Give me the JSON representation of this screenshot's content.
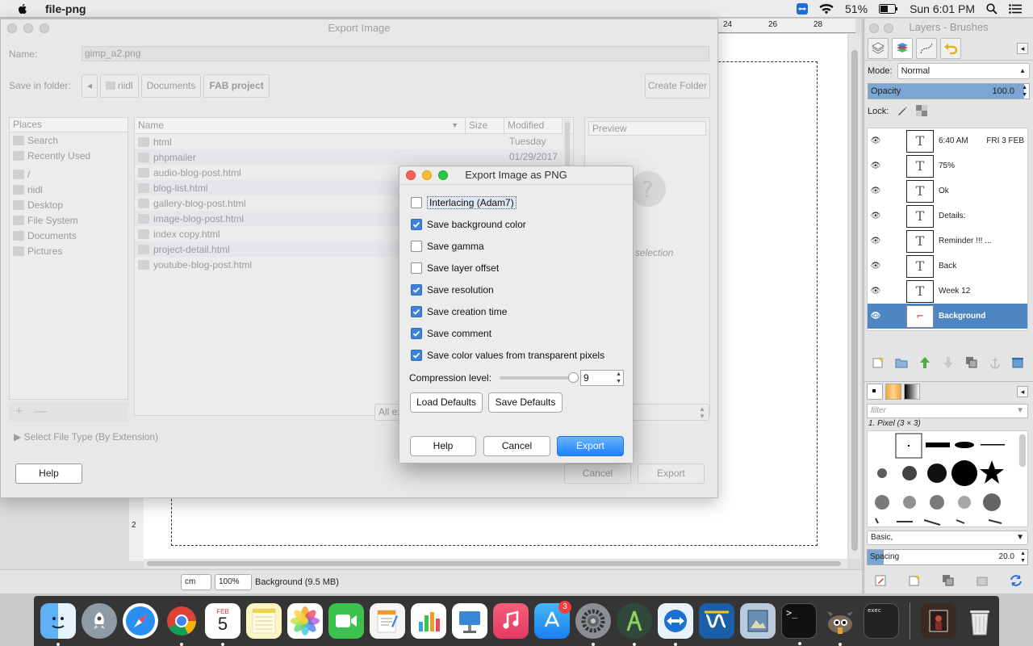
{
  "menubar": {
    "app_name": "file-png",
    "battery": "51%",
    "clock": "Sun 6:01 PM"
  },
  "export_dialog": {
    "title": "Export Image",
    "name_label": "Name:",
    "name_value": "gimp_a2.png",
    "folder_label": "Save in folder:",
    "breadcrumbs": [
      "riidl",
      "Documents",
      "FAB project"
    ],
    "create_folder": "Create Folder",
    "places_header": "Places",
    "places": [
      "Search",
      "Recently Used",
      "/",
      "riidl",
      "Desktop",
      "File System",
      "Documents",
      "Pictures"
    ],
    "columns": {
      "name": "Name",
      "size": "Size",
      "modified": "Modified"
    },
    "files": [
      {
        "name": "html",
        "modified": "Tuesday"
      },
      {
        "name": "phpmailer",
        "modified": "01/29/2017"
      },
      {
        "name": "audio-blog-post.html",
        "modified": ""
      },
      {
        "name": "blog-list.html",
        "modified": ""
      },
      {
        "name": "gallery-blog-post.html",
        "modified": ""
      },
      {
        "name": "image-blog-post.html",
        "modified": ""
      },
      {
        "name": "index copy.html",
        "modified": ""
      },
      {
        "name": "project-detail.html",
        "modified": ""
      },
      {
        "name": "youtube-blog-post.html",
        "modified": ""
      }
    ],
    "preview_label": "Preview",
    "no_selection": "selection",
    "filter_value": "All ex",
    "select_type": "Select File Type (By Extension)",
    "help": "Help",
    "cancel": "Cancel",
    "export": "Export"
  },
  "png_dialog": {
    "title": "Export Image as PNG",
    "options": [
      {
        "label": "Interlacing (Adam7)",
        "checked": false
      },
      {
        "label": "Save background color",
        "checked": true
      },
      {
        "label": "Save gamma",
        "checked": false
      },
      {
        "label": "Save layer offset",
        "checked": false
      },
      {
        "label": "Save resolution",
        "checked": true
      },
      {
        "label": "Save creation time",
        "checked": true
      },
      {
        "label": "Save comment",
        "checked": true
      },
      {
        "label": "Save color values from transparent pixels",
        "checked": true
      }
    ],
    "compression_label": "Compression level:",
    "compression_value": "9",
    "compression_fraction": 1.0,
    "load_defaults": "Load Defaults",
    "save_defaults": "Save Defaults",
    "help": "Help",
    "cancel": "Cancel",
    "export": "Export"
  },
  "layers_panel": {
    "title": "Layers - Brushes",
    "mode_label": "Mode:",
    "mode_value": "Normal",
    "opacity_label": "Opacity",
    "opacity_value": "100.0",
    "lock_label": "Lock:",
    "layers": [
      {
        "name": "6:40 AM",
        "extra": "FRI 3 FEB",
        "selected": false
      },
      {
        "name": "75%",
        "extra": "",
        "selected": false
      },
      {
        "name": "Ok",
        "extra": "",
        "selected": false
      },
      {
        "name": "Details:",
        "extra": "",
        "selected": false
      },
      {
        "name": "Reminder !!! ...",
        "extra": "",
        "selected": false
      },
      {
        "name": "Back",
        "extra": "",
        "selected": false
      },
      {
        "name": "Week 12",
        "extra": "",
        "selected": false
      },
      {
        "name": "Background",
        "extra": "",
        "selected": true
      }
    ],
    "brush_filter_placeholder": "filter",
    "brush_name": "1. Pixel (3 × 3)",
    "brush_set": "Basic,",
    "spacing_label": "Spacing",
    "spacing_value": "20.0"
  },
  "canvas": {
    "ruler_marks": [
      "24",
      "26",
      "28"
    ],
    "left_ruler_mark": "2",
    "unit": "cm",
    "zoom": "100%",
    "status": "Background (9.5 MB)"
  },
  "dock": {
    "calendar_month": "FEB",
    "calendar_day": "5",
    "appstore_badge": "3",
    "terminal_text": ">_",
    "console_text": "exec"
  }
}
